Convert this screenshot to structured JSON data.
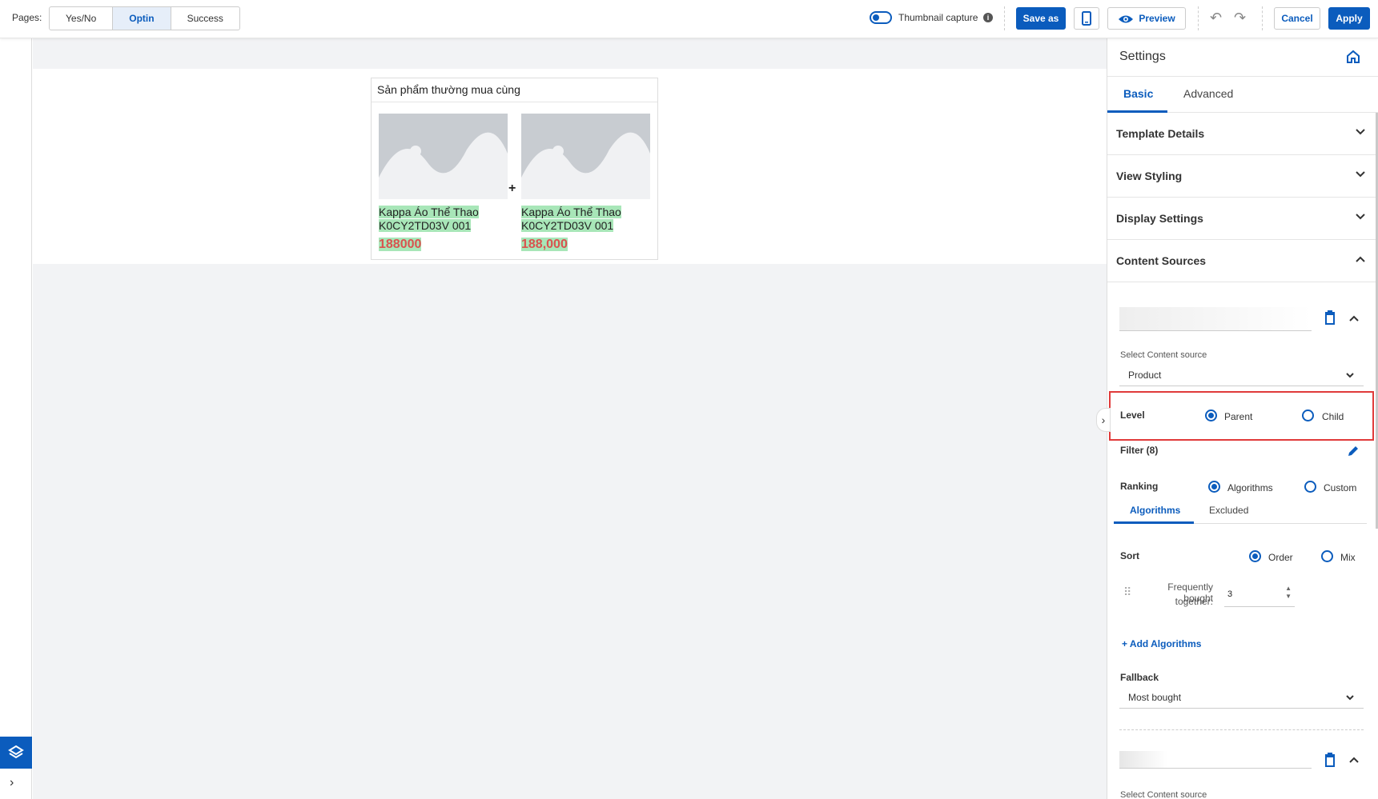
{
  "topbar": {
    "pages_label": "Pages:",
    "pages": [
      "Yes/No",
      "Optin",
      "Success"
    ],
    "active_page": "Optin",
    "thumbnail_label": "Thumbnail capture",
    "save_as": "Save as",
    "preview": "Preview",
    "cancel": "Cancel",
    "apply": "Apply"
  },
  "widget": {
    "title": "Sản phẩm thường mua cùng",
    "products": [
      {
        "name_line1": "Kappa Áo Thể Thao",
        "name_line2": "K0CY2TD03V 001",
        "price": "188000"
      },
      {
        "name_line1": "Kappa Áo Thể Thao",
        "name_line2": "K0CY2TD03V 001",
        "price": "188,000"
      }
    ],
    "separator": "+"
  },
  "panel": {
    "title": "Settings",
    "tabs": [
      "Basic",
      "Advanced"
    ],
    "accordions": [
      "Template Details",
      "View Styling",
      "Display Settings",
      "Content Sources"
    ],
    "select_source_label": "Select Content source",
    "source_value": "Product",
    "level_label": "Level",
    "level_options": [
      "Parent",
      "Child"
    ],
    "filter_label": "Filter (8)",
    "ranking_label": "Ranking",
    "ranking_options": [
      "Algorithms",
      "Custom"
    ],
    "sub_tabs": [
      "Algorithms",
      "Excluded"
    ],
    "sort_label": "Sort",
    "sort_options": [
      "Order",
      "Mix"
    ],
    "algo_name_line1": "Frequently bought",
    "algo_name_line2": "together:",
    "algo_value": "3",
    "add_algorithms": "+ Add Algorithms",
    "fallback_label": "Fallback",
    "fallback_value": "Most bought",
    "select_source_label_2": "Select Content source"
  },
  "colors": {
    "accent": "#0b5cbd",
    "highlight_border": "#e03a3a",
    "price": "#d9534f",
    "text_highlight": "#a8e6b8"
  }
}
